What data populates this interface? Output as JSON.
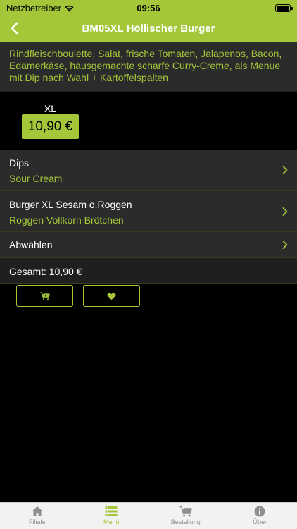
{
  "status_bar": {
    "carrier": "Netzbetreiber",
    "time": "09:56"
  },
  "nav": {
    "title": "BM05XL Höllischer Burger"
  },
  "product": {
    "description": "Rindfleischboulette, Salat, frische Tomaten, Jalapenos, Bacon, Edamerkäse, hausgemachte scharfe Curry-Creme, als Menue mit Dip nach Wahl + Kartoffelspalten",
    "size_label": "XL",
    "size_price": "10,90 €"
  },
  "options": {
    "dips": {
      "title": "Dips",
      "value": "Sour Cream"
    },
    "burger": {
      "title": "Burger XL Sesam o.Roggen",
      "value": "Roggen Vollkorn Brötchen"
    },
    "deselect": {
      "title": "Abwählen"
    }
  },
  "total": {
    "label": "Gesamt: 10,90 €"
  },
  "tabs": [
    {
      "label": "Filiale",
      "icon": "home-icon"
    },
    {
      "label": "Menü",
      "icon": "list-icon"
    },
    {
      "label": "Bestellung",
      "icon": "cart-icon"
    },
    {
      "label": "Über",
      "icon": "info-icon"
    }
  ],
  "colors": {
    "accent": "#a4c639",
    "background": "#000000",
    "row_background": "#2b2b2b",
    "tab_inactive": "#8e8e8e"
  }
}
